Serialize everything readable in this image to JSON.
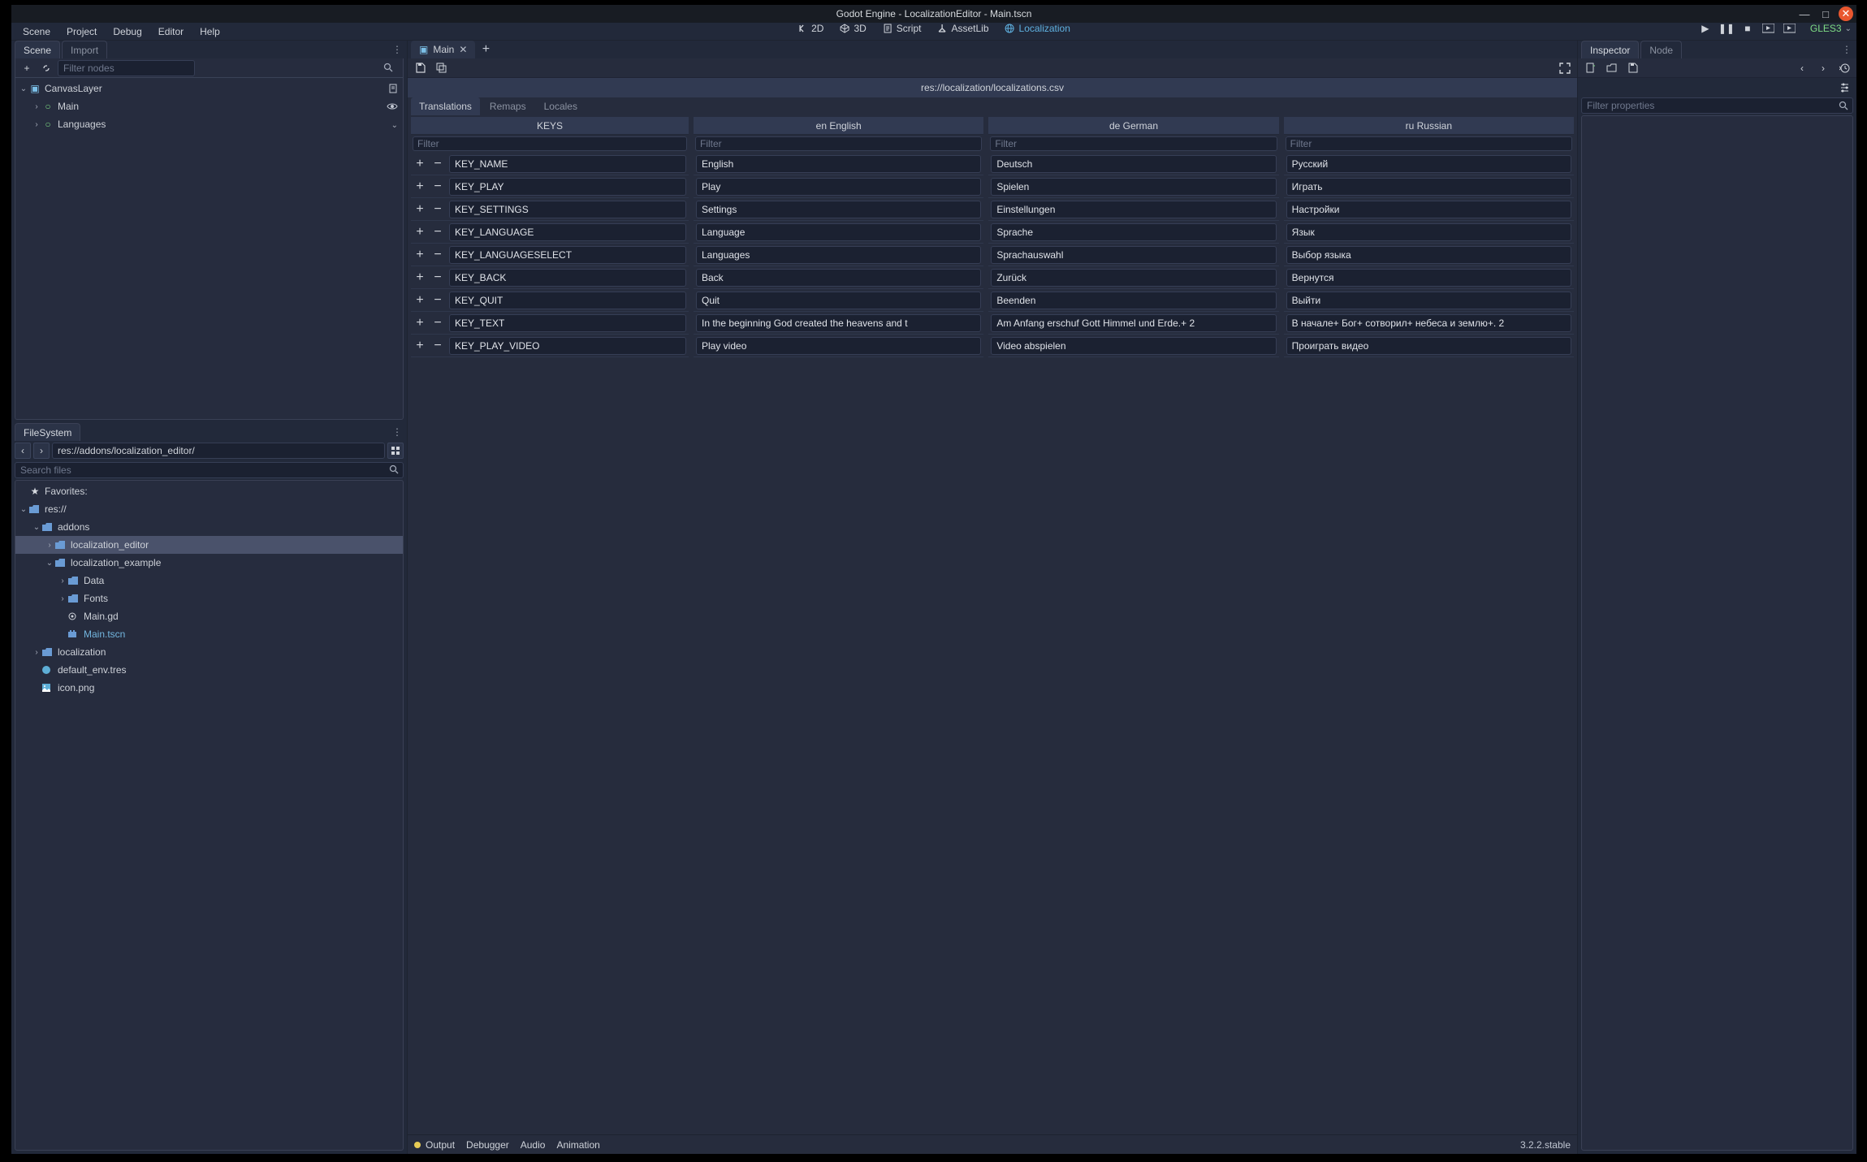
{
  "title": "Godot Engine - LocalizationEditor - Main.tscn",
  "menu": [
    "Scene",
    "Project",
    "Debug",
    "Editor",
    "Help"
  ],
  "centerButtons": [
    {
      "label": "2D",
      "icon": "2d"
    },
    {
      "label": "3D",
      "icon": "3d"
    },
    {
      "label": "Script",
      "icon": "script"
    },
    {
      "label": "AssetLib",
      "icon": "assetlib"
    },
    {
      "label": "Localization",
      "icon": "globe",
      "active": true
    }
  ],
  "playControls": {
    "gles": "GLES3"
  },
  "sceneDock": {
    "tabs": [
      "Scene",
      "Import"
    ],
    "filterPlaceholder": "Filter nodes",
    "tree": [
      {
        "name": "CanvasLayer",
        "indent": 0,
        "fold": "v",
        "icon": "layer",
        "right": [
          "script"
        ]
      },
      {
        "name": "Main",
        "indent": 1,
        "fold": ">",
        "icon": "circle-green",
        "right": [
          "eye"
        ]
      },
      {
        "name": "Languages",
        "indent": 1,
        "fold": ">",
        "icon": "circle-green",
        "right": [
          "chev"
        ]
      }
    ]
  },
  "fsDock": {
    "tab": "FileSystem",
    "path": "res://addons/localization_editor/",
    "searchPlaceholder": "Search files",
    "tree": [
      {
        "label": "Favorites:",
        "indent": 0,
        "icon": "star",
        "fold": ""
      },
      {
        "label": "res://",
        "indent": 0,
        "icon": "folder",
        "fold": "v"
      },
      {
        "label": "addons",
        "indent": 1,
        "icon": "folder",
        "fold": "v"
      },
      {
        "label": "localization_editor",
        "indent": 2,
        "icon": "folder",
        "fold": ">",
        "selected": true
      },
      {
        "label": "localization_example",
        "indent": 2,
        "icon": "folder",
        "fold": "v"
      },
      {
        "label": "Data",
        "indent": 3,
        "icon": "folder",
        "fold": ">"
      },
      {
        "label": "Fonts",
        "indent": 3,
        "icon": "folder",
        "fold": ">"
      },
      {
        "label": "Main.gd",
        "indent": 3,
        "icon": "gd",
        "fold": ""
      },
      {
        "label": "Main.tscn",
        "indent": 3,
        "icon": "tscn",
        "fold": "",
        "activeFile": true
      },
      {
        "label": "localization",
        "indent": 1,
        "icon": "folder",
        "fold": ">"
      },
      {
        "label": "default_env.tres",
        "indent": 1,
        "icon": "tres",
        "fold": ""
      },
      {
        "label": "icon.png",
        "indent": 1,
        "icon": "img",
        "fold": ""
      }
    ]
  },
  "sceneTab": {
    "label": "Main"
  },
  "localization": {
    "filePath": "res://localization/localizations.csv",
    "tabs": [
      "Translations",
      "Remaps",
      "Locales"
    ],
    "activeTab": 0,
    "keysHeader": "KEYS",
    "filterPlaceholder": "Filter",
    "columns": [
      {
        "header": "en English"
      },
      {
        "header": "de German"
      },
      {
        "header": "ru Russian"
      }
    ],
    "rows": [
      {
        "key": "KEY_NAME",
        "vals": [
          "English",
          "Deutsch",
          "Русский"
        ]
      },
      {
        "key": "KEY_PLAY",
        "vals": [
          "Play",
          "Spielen",
          "Играть"
        ]
      },
      {
        "key": "KEY_SETTINGS",
        "vals": [
          "Settings",
          "Einstellungen",
          "Настройки"
        ]
      },
      {
        "key": "KEY_LANGUAGE",
        "vals": [
          "Language",
          "Sprache",
          "Язык"
        ]
      },
      {
        "key": "KEY_LANGUAGESELECT",
        "vals": [
          "Languages",
          "Sprachauswahl",
          "Выбор языка"
        ]
      },
      {
        "key": "KEY_BACK",
        "vals": [
          "Back",
          "Zurück",
          "Вернутся"
        ]
      },
      {
        "key": "KEY_QUIT",
        "vals": [
          "Quit",
          "Beenden",
          "Выйти"
        ]
      },
      {
        "key": "KEY_TEXT",
        "vals": [
          "In the beginning God created the heavens and t",
          "Am Anfang erschuf Gott Himmel und Erde.+ 2",
          "В начале+ Бог+ сотворил+ небеса и землю+. 2"
        ]
      },
      {
        "key": "KEY_PLAY_VIDEO",
        "vals": [
          "Play video",
          "Video abspielen",
          "Проиграть видео"
        ]
      }
    ]
  },
  "inspector": {
    "tabs": [
      "Inspector",
      "Node"
    ],
    "filterPlaceholder": "Filter properties"
  },
  "bottom": {
    "tabs": [
      "Output",
      "Debugger",
      "Audio",
      "Animation"
    ],
    "version": "3.2.2.stable"
  }
}
